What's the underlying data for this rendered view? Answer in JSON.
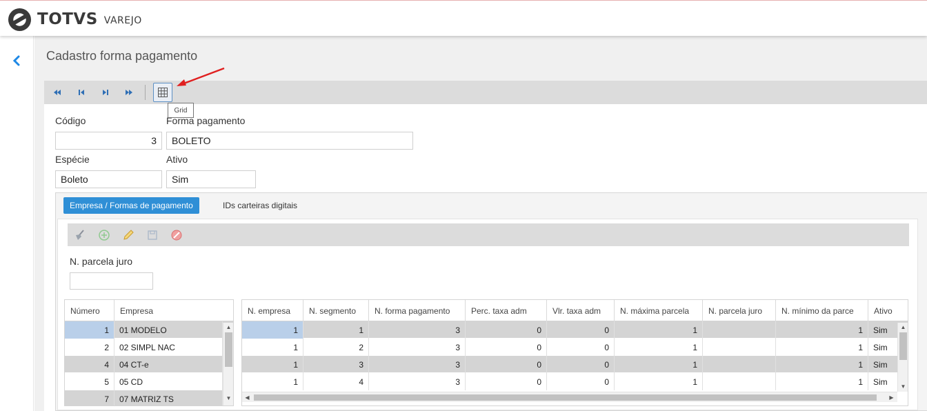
{
  "brand": {
    "name": "TOTVS",
    "product": "VAREJO"
  },
  "page": {
    "title": "Cadastro forma pagamento"
  },
  "toolbar": {
    "tooltip": "Grid"
  },
  "form": {
    "codigo_label": "Código",
    "codigo_value": "3",
    "forma_label": "Forma pagamento",
    "forma_value": "BOLETO",
    "especie_label": "Espécie",
    "especie_value": "Boleto",
    "ativo_label": "Ativo",
    "ativo_value": "Sim"
  },
  "tabs": [
    {
      "label": "Empresa / Formas de pagamento"
    },
    {
      "label": "IDs carteiras digitais"
    }
  ],
  "subform": {
    "parcela_label": "N. parcela juro",
    "parcela_value": ""
  },
  "empresa_table": {
    "headers": [
      "Número",
      "Empresa"
    ],
    "rows": [
      [
        "1",
        "01 MODELO"
      ],
      [
        "2",
        "02 SIMPL NAC"
      ],
      [
        "4",
        "04 CT-e"
      ],
      [
        "5",
        "05 CD"
      ],
      [
        "7",
        "07 MATRIZ TS"
      ]
    ]
  },
  "detail_table": {
    "headers": [
      "N. empresa",
      "N. segmento",
      "N. forma pagamento",
      "Perc. taxa adm",
      "Vlr. taxa adm",
      "N. máxima parcela",
      "N. parcela juro",
      "N. mínimo da parce",
      "Ativo"
    ],
    "rows": [
      [
        "1",
        "1",
        "3",
        "0",
        "0",
        "1",
        "",
        "1",
        "Sim"
      ],
      [
        "1",
        "2",
        "3",
        "0",
        "0",
        "1",
        "",
        "1",
        "Sim"
      ],
      [
        "1",
        "3",
        "3",
        "0",
        "0",
        "1",
        "",
        "1",
        "Sim"
      ],
      [
        "1",
        "4",
        "3",
        "0",
        "0",
        "1",
        "",
        "1",
        "Sim"
      ]
    ]
  },
  "colors": {
    "accent": "#2f8fd6",
    "back_arrow": "#1e88e5",
    "selected_cell": "#b9cfe9",
    "alt_row": "#d4d4d4",
    "annotation_arrow": "#e02020"
  }
}
